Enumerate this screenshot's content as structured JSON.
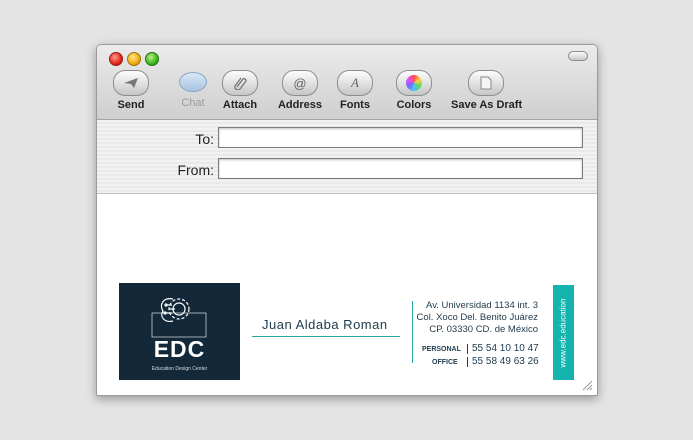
{
  "toolbar": {
    "items": [
      {
        "label": "Send",
        "icon": "send-icon"
      },
      {
        "label": "Chat",
        "icon": "chat-bubble-icon",
        "disabled": true
      },
      {
        "label": "Attach",
        "icon": "paperclip-icon"
      },
      {
        "label": "Address",
        "icon": "at-icon",
        "glyph": "@"
      },
      {
        "label": "Fonts",
        "icon": "fonts-icon",
        "glyph": "A"
      },
      {
        "label": "Colors",
        "icon": "color-wheel-icon"
      },
      {
        "label": "Save As Draft",
        "icon": "draft-document-icon"
      }
    ]
  },
  "header": {
    "to_label": "To:",
    "to_value": "",
    "from_label": "From:",
    "from_value": ""
  },
  "signature": {
    "logo_text": "EDC",
    "logo_subtext": "Education Design Center",
    "name": "Juan Aldaba Roman",
    "address": [
      "Av. Universidad 1134 int. 3",
      "Col. Xoco Del. Benito Juárez",
      "CP. 03330 CD. de México"
    ],
    "phones": [
      {
        "label": "PERSONAL",
        "value": "55 54 10 10 47"
      },
      {
        "label": "OFFICE",
        "value": "55 58 49 63 26"
      }
    ],
    "website": "www.edc.education",
    "colors": {
      "navy": "#13293a",
      "teal": "#15b3ad"
    }
  }
}
